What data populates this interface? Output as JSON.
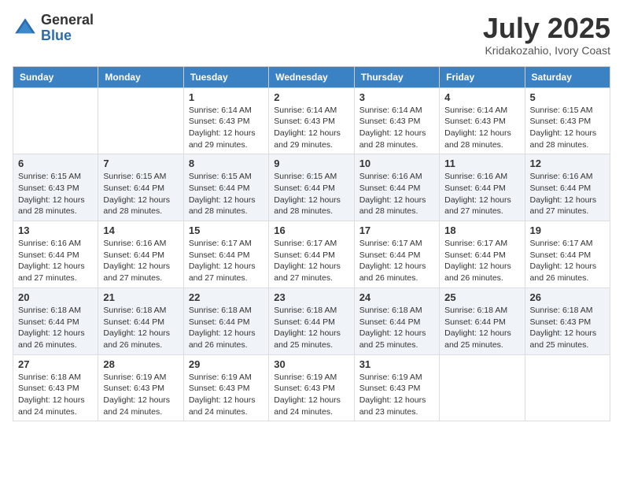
{
  "header": {
    "logo_general": "General",
    "logo_blue": "Blue",
    "month_title": "July 2025",
    "location": "Kridakozahio, Ivory Coast"
  },
  "days_of_week": [
    "Sunday",
    "Monday",
    "Tuesday",
    "Wednesday",
    "Thursday",
    "Friday",
    "Saturday"
  ],
  "weeks": [
    [
      {
        "day": "",
        "info": ""
      },
      {
        "day": "",
        "info": ""
      },
      {
        "day": "1",
        "info": "Sunrise: 6:14 AM\nSunset: 6:43 PM\nDaylight: 12 hours and 29 minutes."
      },
      {
        "day": "2",
        "info": "Sunrise: 6:14 AM\nSunset: 6:43 PM\nDaylight: 12 hours and 29 minutes."
      },
      {
        "day": "3",
        "info": "Sunrise: 6:14 AM\nSunset: 6:43 PM\nDaylight: 12 hours and 28 minutes."
      },
      {
        "day": "4",
        "info": "Sunrise: 6:14 AM\nSunset: 6:43 PM\nDaylight: 12 hours and 28 minutes."
      },
      {
        "day": "5",
        "info": "Sunrise: 6:15 AM\nSunset: 6:43 PM\nDaylight: 12 hours and 28 minutes."
      }
    ],
    [
      {
        "day": "6",
        "info": "Sunrise: 6:15 AM\nSunset: 6:43 PM\nDaylight: 12 hours and 28 minutes."
      },
      {
        "day": "7",
        "info": "Sunrise: 6:15 AM\nSunset: 6:44 PM\nDaylight: 12 hours and 28 minutes."
      },
      {
        "day": "8",
        "info": "Sunrise: 6:15 AM\nSunset: 6:44 PM\nDaylight: 12 hours and 28 minutes."
      },
      {
        "day": "9",
        "info": "Sunrise: 6:15 AM\nSunset: 6:44 PM\nDaylight: 12 hours and 28 minutes."
      },
      {
        "day": "10",
        "info": "Sunrise: 6:16 AM\nSunset: 6:44 PM\nDaylight: 12 hours and 28 minutes."
      },
      {
        "day": "11",
        "info": "Sunrise: 6:16 AM\nSunset: 6:44 PM\nDaylight: 12 hours and 27 minutes."
      },
      {
        "day": "12",
        "info": "Sunrise: 6:16 AM\nSunset: 6:44 PM\nDaylight: 12 hours and 27 minutes."
      }
    ],
    [
      {
        "day": "13",
        "info": "Sunrise: 6:16 AM\nSunset: 6:44 PM\nDaylight: 12 hours and 27 minutes."
      },
      {
        "day": "14",
        "info": "Sunrise: 6:16 AM\nSunset: 6:44 PM\nDaylight: 12 hours and 27 minutes."
      },
      {
        "day": "15",
        "info": "Sunrise: 6:17 AM\nSunset: 6:44 PM\nDaylight: 12 hours and 27 minutes."
      },
      {
        "day": "16",
        "info": "Sunrise: 6:17 AM\nSunset: 6:44 PM\nDaylight: 12 hours and 27 minutes."
      },
      {
        "day": "17",
        "info": "Sunrise: 6:17 AM\nSunset: 6:44 PM\nDaylight: 12 hours and 26 minutes."
      },
      {
        "day": "18",
        "info": "Sunrise: 6:17 AM\nSunset: 6:44 PM\nDaylight: 12 hours and 26 minutes."
      },
      {
        "day": "19",
        "info": "Sunrise: 6:17 AM\nSunset: 6:44 PM\nDaylight: 12 hours and 26 minutes."
      }
    ],
    [
      {
        "day": "20",
        "info": "Sunrise: 6:18 AM\nSunset: 6:44 PM\nDaylight: 12 hours and 26 minutes."
      },
      {
        "day": "21",
        "info": "Sunrise: 6:18 AM\nSunset: 6:44 PM\nDaylight: 12 hours and 26 minutes."
      },
      {
        "day": "22",
        "info": "Sunrise: 6:18 AM\nSunset: 6:44 PM\nDaylight: 12 hours and 26 minutes."
      },
      {
        "day": "23",
        "info": "Sunrise: 6:18 AM\nSunset: 6:44 PM\nDaylight: 12 hours and 25 minutes."
      },
      {
        "day": "24",
        "info": "Sunrise: 6:18 AM\nSunset: 6:44 PM\nDaylight: 12 hours and 25 minutes."
      },
      {
        "day": "25",
        "info": "Sunrise: 6:18 AM\nSunset: 6:44 PM\nDaylight: 12 hours and 25 minutes."
      },
      {
        "day": "26",
        "info": "Sunrise: 6:18 AM\nSunset: 6:43 PM\nDaylight: 12 hours and 25 minutes."
      }
    ],
    [
      {
        "day": "27",
        "info": "Sunrise: 6:18 AM\nSunset: 6:43 PM\nDaylight: 12 hours and 24 minutes."
      },
      {
        "day": "28",
        "info": "Sunrise: 6:19 AM\nSunset: 6:43 PM\nDaylight: 12 hours and 24 minutes."
      },
      {
        "day": "29",
        "info": "Sunrise: 6:19 AM\nSunset: 6:43 PM\nDaylight: 12 hours and 24 minutes."
      },
      {
        "day": "30",
        "info": "Sunrise: 6:19 AM\nSunset: 6:43 PM\nDaylight: 12 hours and 24 minutes."
      },
      {
        "day": "31",
        "info": "Sunrise: 6:19 AM\nSunset: 6:43 PM\nDaylight: 12 hours and 23 minutes."
      },
      {
        "day": "",
        "info": ""
      },
      {
        "day": "",
        "info": ""
      }
    ]
  ]
}
